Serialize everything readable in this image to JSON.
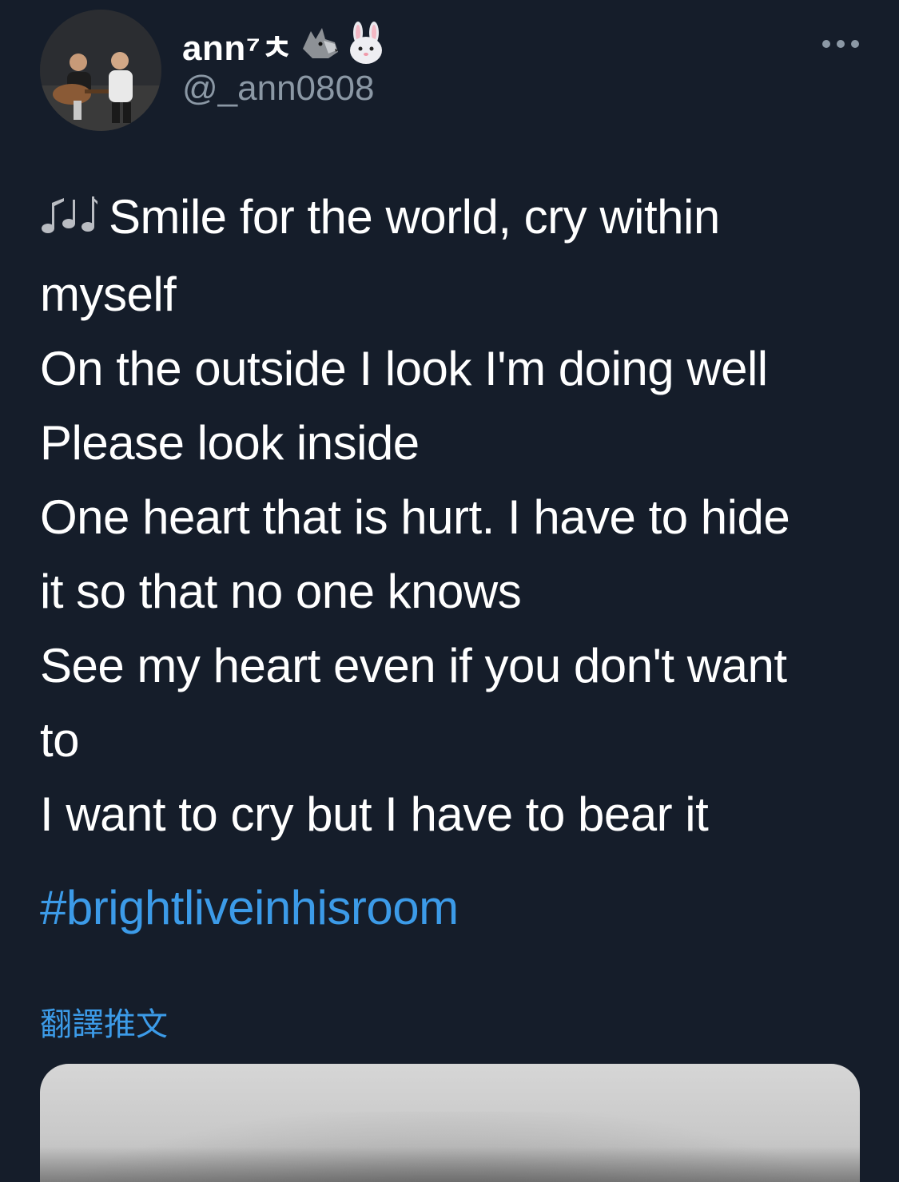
{
  "author": {
    "display_name": "ann⁷ㅊ",
    "handle": "@_ann0808",
    "badge_icons": [
      "wolf-emoji",
      "rabbit-emoji"
    ]
  },
  "tweet": {
    "lead_icon": "musical-notes-emoji",
    "lines": [
      "Smile for the world, cry within",
      "myself",
      "On the outside I look I'm doing well",
      "Please look inside",
      "One heart that is hurt. I have to hide",
      "it so that no one knows",
      "See my heart even if you don't want",
      "to",
      "I want to cry but I have to bear it"
    ],
    "hashtag": "#brightliveinhisroom",
    "translate_label": "翻譯推文"
  },
  "colors": {
    "background": "#151d2a",
    "text": "#ffffff",
    "secondary": "#8b98a5",
    "link": "#3c9be8"
  }
}
